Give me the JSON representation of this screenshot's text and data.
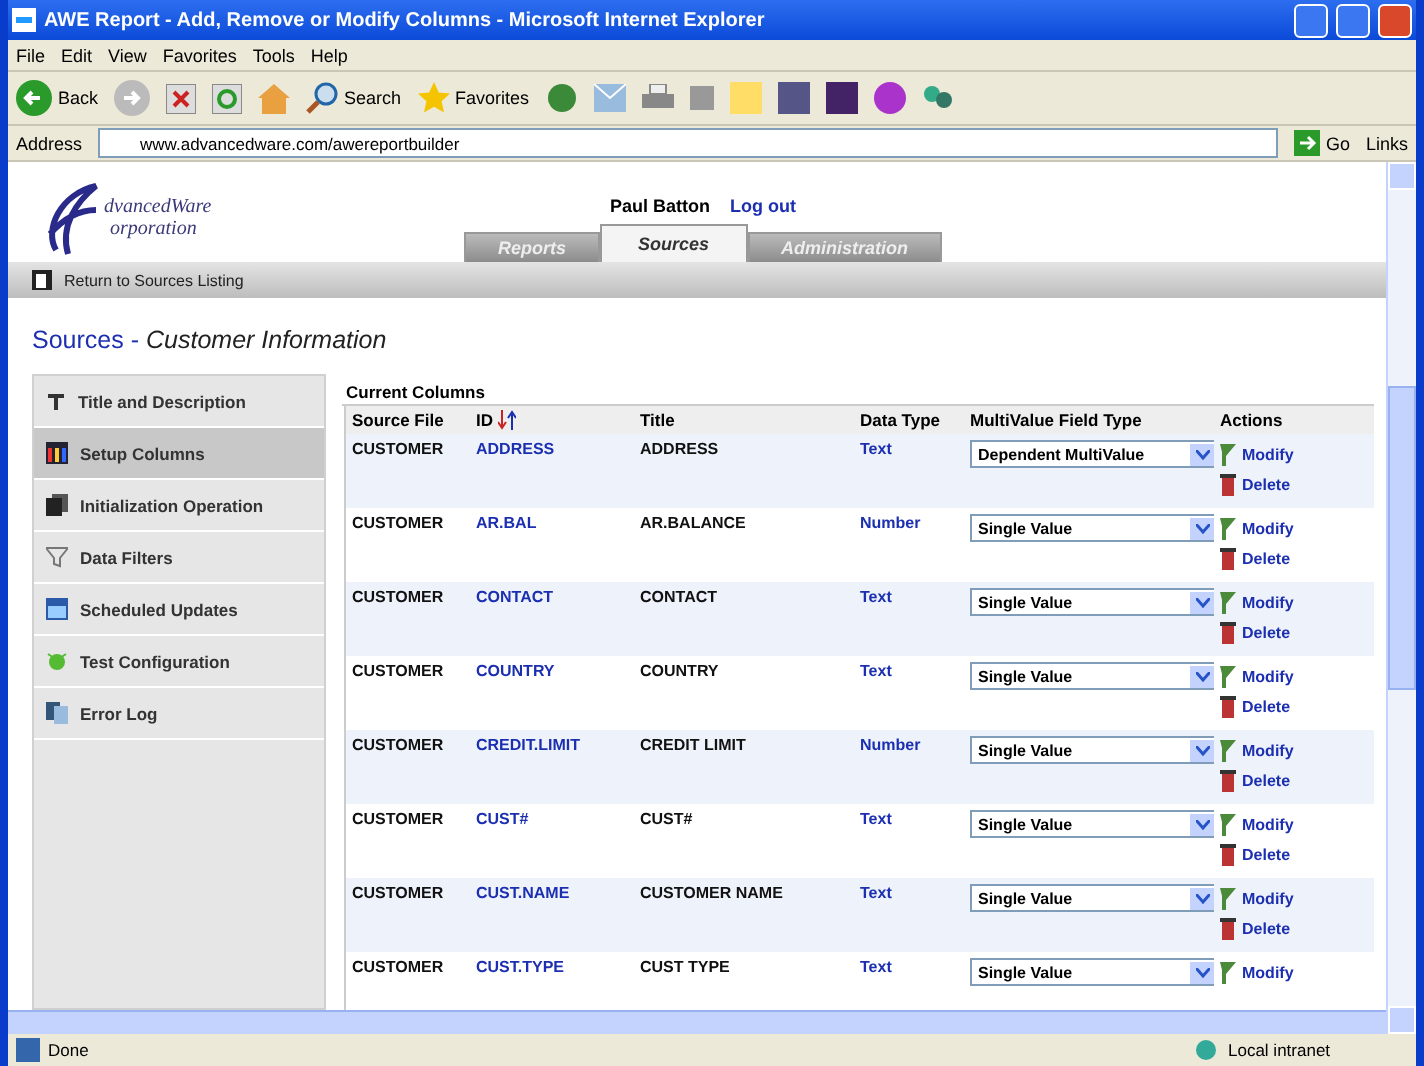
{
  "window": {
    "title": "AWE Report - Add, Remove or Modify Columns - Microsoft Internet Explorer"
  },
  "menu": [
    "File",
    "Edit",
    "View",
    "Favorites",
    "Tools",
    "Help"
  ],
  "toolbar": {
    "back": "Back",
    "search": "Search",
    "favorites": "Favorites"
  },
  "address": {
    "label": "Address",
    "url": "www.advancedware.com/awereportbuilder",
    "go": "Go",
    "links": "Links"
  },
  "header": {
    "logo": [
      "dvancedWare",
      "orporation"
    ],
    "user": "Paul Batton",
    "logout": "Log out"
  },
  "tabs": [
    {
      "label": "Reports",
      "selected": false
    },
    {
      "label": "Sources",
      "selected": true
    },
    {
      "label": "Administration",
      "selected": false
    }
  ],
  "return_link": "Return to Sources Listing",
  "page_title": {
    "section": "Sources",
    "separator": "-",
    "name": "Customer Information"
  },
  "sidebar": [
    {
      "label": "Title and Description",
      "selected": false
    },
    {
      "label": "Setup Columns",
      "selected": true
    },
    {
      "label": "Initialization Operation",
      "selected": false
    },
    {
      "label": "Data Filters",
      "selected": false
    },
    {
      "label": "Scheduled Updates",
      "selected": false
    },
    {
      "label": "Test Configuration",
      "selected": false
    },
    {
      "label": "Error Log",
      "selected": false
    }
  ],
  "table": {
    "caption": "Current Columns",
    "columns": [
      "Source File",
      "ID",
      "Title",
      "Data Type",
      "MultiValue Field Type",
      "Actions"
    ],
    "rows": [
      {
        "source": "CUSTOMER",
        "id": "ADDRESS",
        "title": "ADDRESS",
        "type": "Text",
        "multivalue": "Dependent MultiValue",
        "actions": [
          "Modify",
          "Delete"
        ]
      },
      {
        "source": "CUSTOMER",
        "id": "AR.BAL",
        "title": "AR.BALANCE",
        "type": "Number",
        "multivalue": "Single Value",
        "actions": [
          "Modify",
          "Delete"
        ]
      },
      {
        "source": "CUSTOMER",
        "id": "CONTACT",
        "title": "CONTACT",
        "type": "Text",
        "multivalue": "Single Value",
        "actions": [
          "Modify",
          "Delete"
        ]
      },
      {
        "source": "CUSTOMER",
        "id": "COUNTRY",
        "title": "COUNTRY",
        "type": "Text",
        "multivalue": "Single Value",
        "actions": [
          "Modify",
          "Delete"
        ]
      },
      {
        "source": "CUSTOMER",
        "id": "CREDIT.LIMIT",
        "title": "CREDIT LIMIT",
        "type": "Number",
        "multivalue": "Single Value",
        "actions": [
          "Modify",
          "Delete"
        ]
      },
      {
        "source": "CUSTOMER",
        "id": "CUST#",
        "title": "CUST#",
        "type": "Text",
        "multivalue": "Single Value",
        "actions": [
          "Modify",
          "Delete"
        ]
      },
      {
        "source": "CUSTOMER",
        "id": "CUST.NAME",
        "title": "CUSTOMER NAME",
        "type": "Text",
        "multivalue": "Single Value",
        "actions": [
          "Modify",
          "Delete"
        ]
      },
      {
        "source": "CUSTOMER",
        "id": "CUST.TYPE",
        "title": "CUST TYPE",
        "type": "Text",
        "multivalue": "Single Value",
        "actions": [
          "Modify"
        ]
      }
    ]
  },
  "status_bar": {
    "text": "Done",
    "zone": "Local intranet"
  }
}
